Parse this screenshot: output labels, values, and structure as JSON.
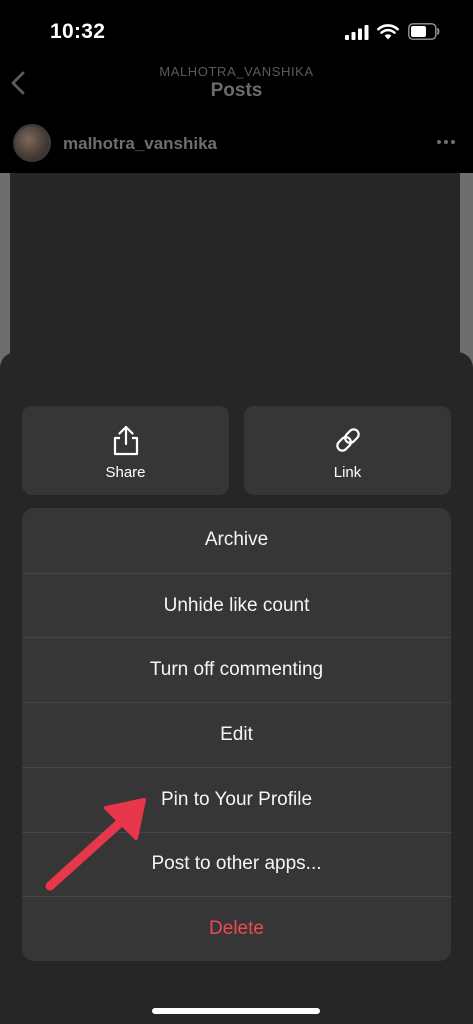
{
  "status_bar": {
    "time": "10:32",
    "signal_icon": "cellular-signal-icon",
    "wifi_icon": "wifi-icon",
    "battery_icon": "battery-icon"
  },
  "header": {
    "subtitle": "MALHOTRA_VANSHIKA",
    "title": "Posts",
    "back_icon": "chevron-left-icon"
  },
  "post": {
    "username": "malhotra_vanshika",
    "more_icon": "more-horizontal-icon"
  },
  "sheet": {
    "share_label": "Share",
    "share_icon": "share-icon",
    "link_label": "Link",
    "link_icon": "link-icon",
    "menu": [
      {
        "label": "Archive"
      },
      {
        "label": "Unhide like count"
      },
      {
        "label": "Turn off commenting"
      },
      {
        "label": "Edit"
      },
      {
        "label": "Pin to Your Profile"
      },
      {
        "label": "Post to other apps..."
      },
      {
        "label": "Delete"
      }
    ]
  },
  "colors": {
    "danger": "#ed4956",
    "annotation_arrow": "#e8374a",
    "sheet_background": "#262626",
    "tile_background": "#363636"
  }
}
